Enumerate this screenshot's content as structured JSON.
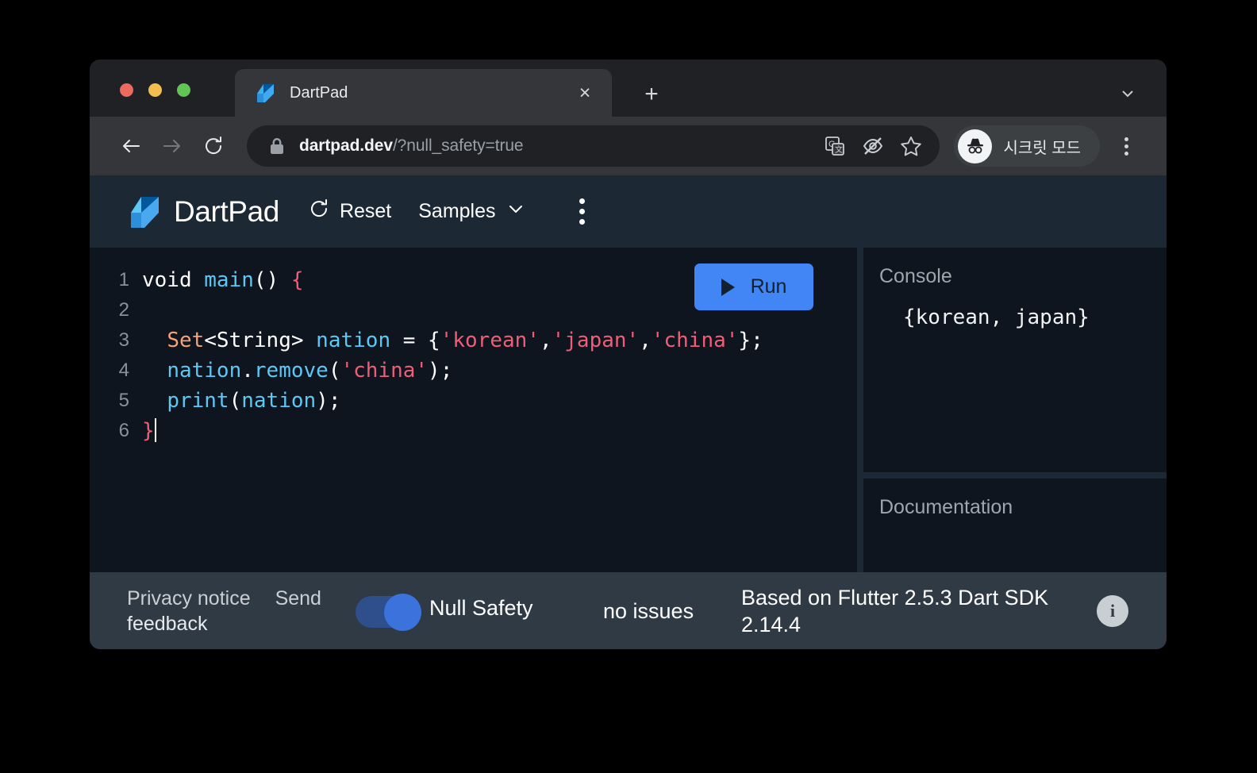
{
  "browser": {
    "traffic_lights": [
      "close",
      "minimize",
      "maximize"
    ],
    "tab": {
      "title": "DartPad",
      "favicon": "dart-logo-icon",
      "close_label": "×"
    },
    "new_tab_label": "+",
    "tabstrip_chevron": "chevron-down-icon",
    "toolbar": {
      "back": "back-arrow-icon",
      "forward": "forward-arrow-icon",
      "reload": "reload-icon",
      "lock": "lock-icon",
      "url_host": "dartpad.dev",
      "url_path": "/?null_safety=true",
      "url_full": "dartpad.dev/?null_safety=true",
      "translate_icon": "translate-icon",
      "eye_off_icon": "eye-off-icon",
      "bookmark_icon": "star-icon",
      "incognito_label": "시크릿 모드",
      "menu_icon": "kebab-menu-icon"
    }
  },
  "dartpad": {
    "header": {
      "logo": "dart-logo-icon",
      "title": "DartPad",
      "reset_label": "Reset",
      "reset_icon": "refresh-icon",
      "samples_label": "Samples",
      "samples_chevron": "chevron-down-icon",
      "more_icon": "kebab-menu-icon"
    },
    "run_button": {
      "label": "Run",
      "icon": "play-icon",
      "color": "#4285F4"
    },
    "editor": {
      "lines": [
        {
          "num": "1",
          "tokens": [
            {
              "t": "void ",
              "c": "tk-kw"
            },
            {
              "t": "main",
              "c": "tk-fn"
            },
            {
              "t": "() ",
              "c": "tk-punct"
            },
            {
              "t": "{",
              "c": "tk-brace"
            }
          ]
        },
        {
          "num": "2",
          "tokens": []
        },
        {
          "num": "3",
          "tokens": [
            {
              "t": "  ",
              "c": "tk-punct"
            },
            {
              "t": "Set",
              "c": "tk-type"
            },
            {
              "t": "<String> ",
              "c": "tk-punct"
            },
            {
              "t": "nation",
              "c": "tk-ident"
            },
            {
              "t": " = {",
              "c": "tk-punct"
            },
            {
              "t": "'korean'",
              "c": "tk-str"
            },
            {
              "t": ",",
              "c": "tk-punct"
            },
            {
              "t": "'japan'",
              "c": "tk-str"
            },
            {
              "t": ",",
              "c": "tk-punct"
            },
            {
              "t": "'china'",
              "c": "tk-str"
            },
            {
              "t": "};",
              "c": "tk-punct"
            }
          ]
        },
        {
          "num": "4",
          "tokens": [
            {
              "t": "  ",
              "c": "tk-punct"
            },
            {
              "t": "nation",
              "c": "tk-ident"
            },
            {
              "t": ".",
              "c": "tk-punct"
            },
            {
              "t": "remove",
              "c": "tk-fn"
            },
            {
              "t": "(",
              "c": "tk-punct"
            },
            {
              "t": "'china'",
              "c": "tk-str"
            },
            {
              "t": ");",
              "c": "tk-punct"
            }
          ]
        },
        {
          "num": "5",
          "tokens": [
            {
              "t": "  ",
              "c": "tk-punct"
            },
            {
              "t": "print",
              "c": "tk-fn"
            },
            {
              "t": "(",
              "c": "tk-punct"
            },
            {
              "t": "nation",
              "c": "tk-ident"
            },
            {
              "t": ");",
              "c": "tk-punct"
            }
          ]
        },
        {
          "num": "6",
          "tokens": [
            {
              "t": "}",
              "c": "tk-brace"
            }
          ],
          "caret": true
        }
      ]
    },
    "console": {
      "title": "Console",
      "output": "{korean, japan}"
    },
    "documentation": {
      "title": "Documentation",
      "body": ""
    },
    "footer": {
      "privacy_label": "Privacy notice",
      "feedback_label": "Send feedback",
      "privacy_line1": "Privacy notice",
      "privacy_line2": "feedback",
      "send_label": "Send",
      "null_safety_label": "Null Safety",
      "null_safety_on": true,
      "issues_label": "no issues",
      "sdk_label": "Based on Flutter 2.5.3 Dart SDK 2.14.4",
      "info_icon": "info-icon",
      "info_glyph": "i"
    }
  }
}
